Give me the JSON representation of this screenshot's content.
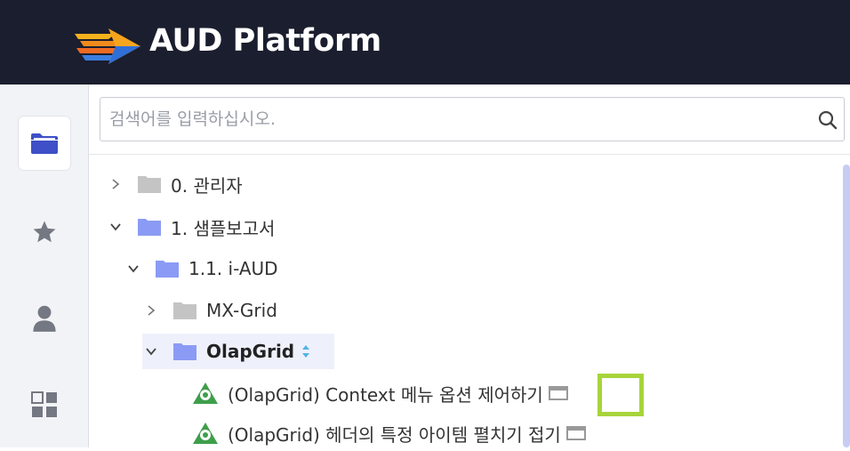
{
  "app": {
    "title": "AUD Platform"
  },
  "sidebar": {
    "items": [
      {
        "id": "folder",
        "active": true
      },
      {
        "id": "favorites",
        "active": false
      },
      {
        "id": "user",
        "active": false
      },
      {
        "id": "apps",
        "active": false
      }
    ]
  },
  "search": {
    "placeholder": "검색어를 입력하십시오."
  },
  "tree": [
    {
      "label": "0. 관리자",
      "expanded": false,
      "level": 0
    },
    {
      "label": "1. 샘플보고서",
      "expanded": true,
      "level": 0
    },
    {
      "label": "1.1. i-AUD",
      "expanded": true,
      "level": 1
    },
    {
      "label": "MX-Grid",
      "expanded": false,
      "level": 2
    },
    {
      "label": "OlapGrid",
      "expanded": true,
      "level": 2,
      "selected": true
    },
    {
      "label": "(OlapGrid) Context 메뉴 옵션 제어하기",
      "level": 3,
      "type": "report"
    },
    {
      "label": "(OlapGrid) 헤더의 특정 아이템 펼치기 접기",
      "level": 3,
      "type": "report"
    }
  ],
  "colors": {
    "header_bg": "#1b1e2e",
    "accent": "#4657d4",
    "folder_open": "#8b9bf5",
    "folder_closed": "#c4c4c4",
    "report_icon": "#3e9e4b",
    "highlight": "#a7d43b"
  }
}
